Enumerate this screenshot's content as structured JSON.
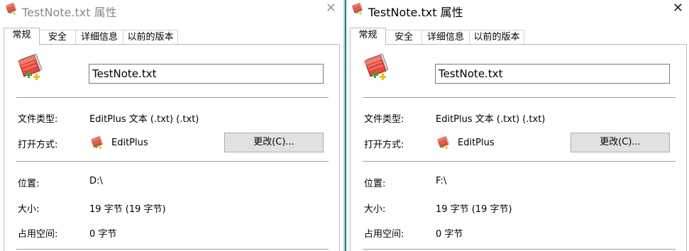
{
  "windows": [
    {
      "title": "TestNote.txt 属性",
      "close_glyph": "✕",
      "tabs": [
        "常规",
        "安全",
        "详细信息",
        "以前的版本"
      ],
      "active_tab": 0,
      "filename": "TestNote.txt",
      "file_type_label": "文件类型:",
      "file_type_value": "EditPlus 文本 (.txt) (.txt)",
      "open_with_label": "打开方式:",
      "open_with_app": "EditPlus",
      "change_button": "更改(C)...",
      "location_label": "位置:",
      "location_value": "D:\\",
      "size_label": "大小:",
      "size_value": "19 字节 (19 字节)",
      "size_on_disk_label": "占用空间:",
      "size_on_disk_value": "0 字节",
      "focused": false
    },
    {
      "title": "TestNote.txt 属性",
      "close_glyph": "✕",
      "tabs": [
        "常规",
        "安全",
        "详细信息",
        "以前的版本"
      ],
      "active_tab": 0,
      "filename": "TestNote.txt",
      "file_type_label": "文件类型:",
      "file_type_value": "EditPlus 文本 (.txt) (.txt)",
      "open_with_label": "打开方式:",
      "open_with_app": "EditPlus",
      "change_button": "更改(C)...",
      "location_label": "位置:",
      "location_value": "F:\\",
      "size_label": "大小:",
      "size_value": "19 字节 (19 字节)",
      "size_on_disk_label": "占用空间:",
      "size_on_disk_value": "0 字节",
      "focused": true
    }
  ],
  "colors": {
    "active_border": "#0f8a7e",
    "inactive_title_text": "#8a8a8a",
    "button_face": "#e1e1e1"
  },
  "icons": {
    "file_icon": "editplus-notebook-icon",
    "close": "close-icon"
  }
}
